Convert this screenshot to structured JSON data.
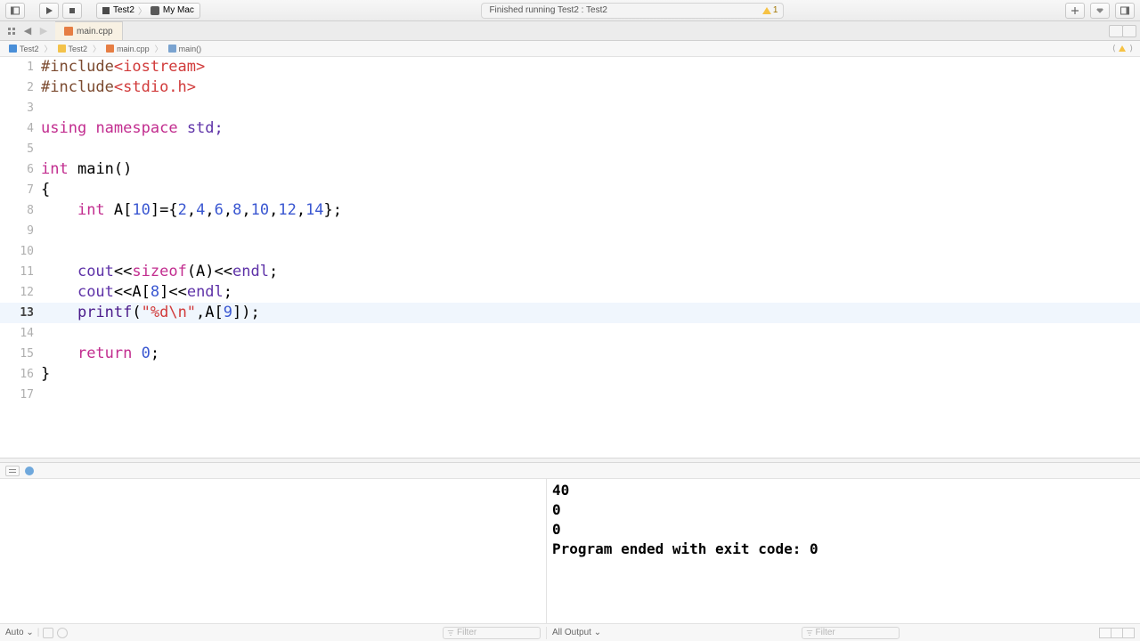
{
  "toolbar": {
    "scheme_target": "Test2",
    "scheme_dest": "My Mac",
    "status": "Finished running Test2 : Test2",
    "warn_count": "1"
  },
  "tab": {
    "filename": "main.cpp"
  },
  "breadcrumb": {
    "p0": "Test2",
    "p1": "Test2",
    "p2": "main.cpp",
    "p3": "main()"
  },
  "code": {
    "l1_a": "#include",
    "l1_b": "<iostream>",
    "l2_a": "#include",
    "l2_b": "<stdio.h>",
    "l4_a": "using",
    "l4_b": "namespace",
    "l4_c": "std;",
    "l6_a": "int",
    "l6_b": "main",
    "l6_c": "()",
    "l7": "{",
    "l8_a": "int",
    "l8_b": " A[",
    "l8_c": "10",
    "l8_d": "]={",
    "l8_e": "2",
    "l8_f": ",",
    "l8_g": "4",
    "l8_h": ",",
    "l8_i": "6",
    "l8_j": ",",
    "l8_k": "8",
    "l8_l": ",",
    "l8_m": "10",
    "l8_n": ",",
    "l8_o": "12",
    "l8_p": ",",
    "l8_q": "14",
    "l8_r": "};",
    "l11_a": "cout",
    "l11_b": "<<",
    "l11_c": "sizeof",
    "l11_d": "(A)<<",
    "l11_e": "endl",
    "l11_f": ";",
    "l12_a": "cout",
    "l12_b": "<<A[",
    "l12_c": "8",
    "l12_d": "]<<",
    "l12_e": "endl",
    "l12_f": ";",
    "l13_a": "printf",
    "l13_b": "(",
    "l13_c": "\"%d\\n\"",
    "l13_d": ",A[",
    "l13_e": "9",
    "l13_f": "]);",
    "l15_a": "return",
    "l15_b": " ",
    "l15_c": "0",
    "l15_d": ";",
    "l16": "}"
  },
  "ln": {
    "1": "1",
    "2": "2",
    "3": "3",
    "4": "4",
    "5": "5",
    "6": "6",
    "7": "7",
    "8": "8",
    "9": "9",
    "10": "10",
    "11": "11",
    "12": "12",
    "13": "13",
    "14": "14",
    "15": "15",
    "16": "16",
    "17": "17"
  },
  "console": {
    "o1": "40",
    "o2": "0",
    "o3": "0",
    "o4": "Program ended with exit code: 0"
  },
  "footer": {
    "auto": "Auto ⌄",
    "all_output": "All Output ⌄",
    "filter_ph": "Filter"
  }
}
